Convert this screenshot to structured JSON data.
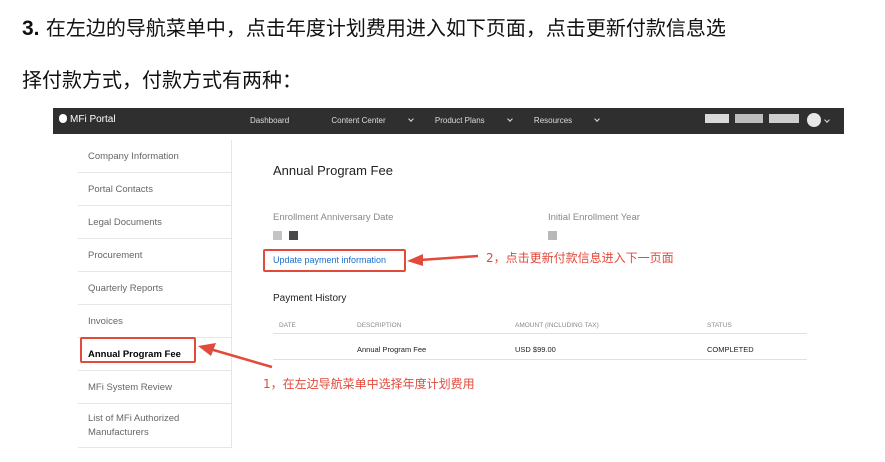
{
  "instructions": {
    "step_number": "3.",
    "line1_text": "在左边的导航菜单中，点击年度计划费用进入如下页面，点击更新付款信息选",
    "line2_text": "择付款方式，付款方式有两种："
  },
  "topbar": {
    "brand": "MFi Portal",
    "nav": [
      "Dashboard",
      "Content Center",
      "Product Plans",
      "Resources"
    ]
  },
  "sidebar": {
    "items": [
      "Company Information",
      "Portal Contacts",
      "Legal Documents",
      "Procurement",
      "Quarterly Reports",
      "Invoices",
      "Annual Program Fee",
      "MFi System Review",
      "List of MFi Authorized Manufacturers"
    ],
    "active_index": 6
  },
  "main": {
    "title": "Annual Program Fee",
    "enrollment_label": "Enrollment Anniversary Date",
    "initial_year_label": "Initial Enrollment Year",
    "update_link": "Update payment information",
    "history_title": "Payment History",
    "table": {
      "headers": [
        "DATE",
        "DESCRIPTION",
        "AMOUNT (INCLUDING TAX)",
        "STATUS"
      ],
      "rows": [
        [
          "",
          "Annual Program Fee",
          "USD $99.00",
          "COMPLETED"
        ]
      ]
    }
  },
  "annotations": {
    "step1": "1，在左边导航菜单中选择年度计划费用",
    "step2": "2，点击更新付款信息进入下一页面"
  },
  "colors": {
    "accent_red": "#e24a3b",
    "link_blue": "#1a6fd1",
    "topbar": "#2f2f2f"
  }
}
